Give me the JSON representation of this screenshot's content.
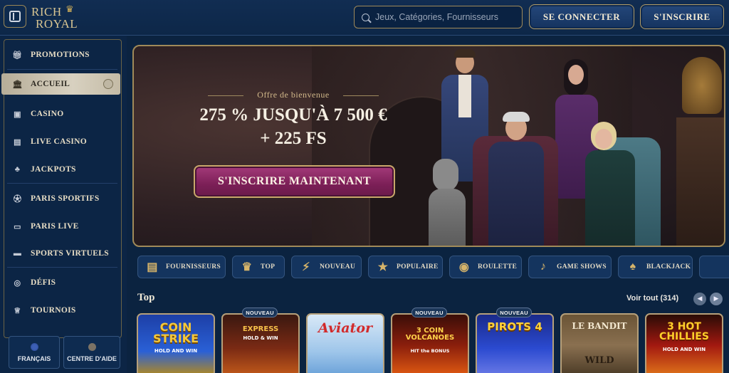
{
  "header": {
    "logo_line1": "RICH",
    "logo_line2": "ROYAL",
    "search_placeholder": "Jeux, Catégories, Fournisseurs",
    "login_label": "SE CONNECTER",
    "signup_label": "S'INSCRIRE"
  },
  "sidebar": {
    "items": [
      {
        "label": "PROMOTIONS",
        "icon": "gift-icon"
      },
      {
        "label": "ACCUEIL",
        "icon": "home-icon",
        "active": true
      },
      {
        "label": "CASINO",
        "icon": "slot-machine-icon"
      },
      {
        "label": "LIVE CASINO",
        "icon": "cards-icon"
      },
      {
        "label": "JACKPOTS",
        "icon": "clover-icon"
      },
      {
        "label": "PARIS SPORTIFS",
        "icon": "ball-icon"
      },
      {
        "label": "PARIS LIVE",
        "icon": "live-icon"
      },
      {
        "label": "SPORTS VIRTUELS",
        "icon": "monitor-icon"
      },
      {
        "label": "DÉFIS",
        "icon": "target-icon"
      },
      {
        "label": "TOURNOIS",
        "icon": "trophy-icon"
      }
    ],
    "language_label": "FRANÇAIS",
    "help_label": "CENTRE D'AIDE"
  },
  "banner": {
    "offer_label": "Offre de bienvenue",
    "line1": "275 % JUSQU'À 7 500 €",
    "line2": "+ 225 FS",
    "cta_label": "S'INSCRIRE MAINTENANT"
  },
  "categories": [
    {
      "label": "FOURNISSEURS",
      "icon": "book-icon"
    },
    {
      "label": "TOP",
      "icon": "crown-icon"
    },
    {
      "label": "NOUVEAU",
      "icon": "lightning-icon"
    },
    {
      "label": "POPULAIRE",
      "icon": "star-icon"
    },
    {
      "label": "ROULETTE",
      "icon": "roulette-icon"
    },
    {
      "label": "GAME SHOWS",
      "icon": "microphone-icon"
    },
    {
      "label": "BLACKJACK",
      "icon": "blackjack-icon"
    }
  ],
  "top_section": {
    "title": "Top",
    "see_all_label": "Voir tout (314)"
  },
  "games": [
    {
      "title": "COIN STRIKE",
      "subtitle": "HOLD AND WIN",
      "new": false
    },
    {
      "title": "EXPRESS",
      "subtitle": "HOLD & WIN",
      "new": true
    },
    {
      "title": "Aviator",
      "subtitle": "",
      "new": false
    },
    {
      "title": "3 COIN VOLCANOES",
      "subtitle": "HIT the BONUS",
      "new": true
    },
    {
      "title": "PIROTS 4",
      "subtitle": "",
      "new": true
    },
    {
      "title": "LE BANDIT",
      "subtitle": "WILD",
      "new": false
    },
    {
      "title": "3 HOT CHILLIES",
      "subtitle": "HOLD AND WIN",
      "new": false
    }
  ],
  "badge_label": "NOUVEAU",
  "colors": {
    "background": "#0b2340",
    "gold": "#b29c67",
    "cta_magenta": "#8a2562",
    "active_nav": "#d0c8b6"
  }
}
